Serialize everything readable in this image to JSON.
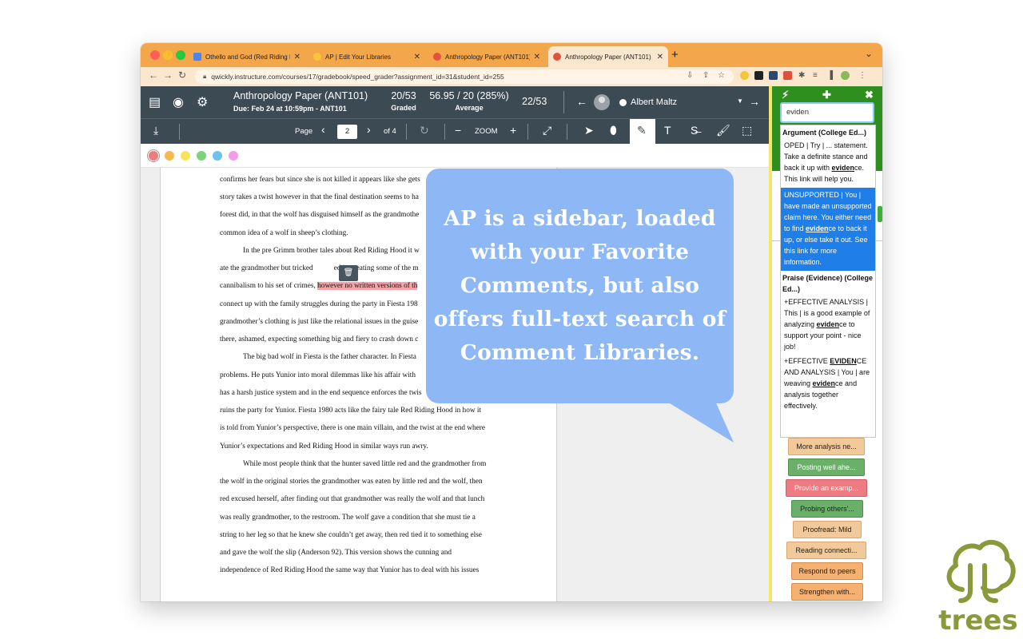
{
  "browser": {
    "tabs": [
      {
        "label": "Othello and God (Red Riding H",
        "color": "#4a86e8"
      },
      {
        "label": "AP | Edit Your Libraries",
        "color": "#f3c63b"
      },
      {
        "label": "Anthropology Paper (ANT101)",
        "color": "#e2533c"
      },
      {
        "label": "Anthropology Paper (ANT101)",
        "color": "#e2533c"
      }
    ],
    "new_tab": "+",
    "url": "qwickly.instructure.com/courses/17/gradebook/speed_grader?assignment_id=31&student_id=255"
  },
  "speedgrader": {
    "title": "Anthropology Paper (ANT101)",
    "due": "Due: Feb 24 at 10:59pm - ANT101",
    "graded_value": "20/53",
    "graded_label": "Graded",
    "average_value": "56.95 / 20 (285%)",
    "average_label": "Average",
    "position": "22/53",
    "student": "Albert Maltz"
  },
  "toolbar": {
    "page_label": "Page",
    "page_value": "2",
    "of_label": "of 4",
    "zoom_label": "ZOOM",
    "icons": [
      "download-icon",
      "rotate-icon",
      "zoom-out-icon",
      "zoom-in-icon",
      "fullscreen-icon",
      "pointer-icon",
      "pin-icon",
      "highlight-icon",
      "text-icon",
      "strikeout-icon",
      "draw-icon",
      "area-icon"
    ]
  },
  "annotation_colors": [
    "#ee7b80",
    "#f6b94d",
    "#f7e45a",
    "#7bd37b",
    "#6cc1f2",
    "#f59be8"
  ],
  "document": {
    "lines": [
      {
        "text": "confirms her fears but since she is not killed it appears like she gets",
        "indent": false
      },
      {
        "text": "story takes a twist however in that the final destination seems to ha",
        "indent": false
      },
      {
        "text": "forest did, in that the wolf has disguised himself as the grandmothe",
        "indent": false
      },
      {
        "text": "common idea of a wolf in sheep’s clothing.",
        "indent": false
      },
      {
        "text": "In the pre Grimm brother tales about Red Riding Hood it w",
        "indent": true
      },
      {
        "text": "ate the grandmother but tricked",
        "tail": "ed into eating some of the m",
        "indent": false
      },
      {
        "text": "cannibalism to his set of crimes, ",
        "highlight": "however no written versions of th",
        "indent": false
      },
      {
        "text": "connect up with the family struggles during the party in Fiesta 198",
        "indent": false
      },
      {
        "text": "grandmother’s clothing is just like the relational issues in the guise",
        "indent": false
      },
      {
        "text": "there, ashamed, expecting something big and fiery to crash down c",
        "indent": false
      },
      {
        "text": "The big bad wolf in Fiesta is the father character. In Fiesta",
        "indent": true
      },
      {
        "text": "problems. He puts Yunior into moral dilemmas like his affair with",
        "indent": false
      },
      {
        "text": "has a harsh justice system and in the end sequence enforces the twis",
        "indent": false
      },
      {
        "text": "ruins the party for Yunior. Fiesta 1980 acts like the fairy tale Red Riding Hood in how it",
        "indent": false
      },
      {
        "text": "is told from Yunior’s perspective, there is one main villain, and the twist at the end where",
        "indent": false
      },
      {
        "text": "Yunior’s expectations and Red Riding Hood in similar ways run awry.",
        "indent": false
      },
      {
        "text": "While most people think that the hunter saved little red and the grandmother from",
        "indent": true
      },
      {
        "text": "the wolf in the original stories the grandmother was eaten by little red and the wolf, then",
        "indent": false
      },
      {
        "text": "red excused herself, after finding out that grandmother was really the wolf and that lunch",
        "indent": false
      },
      {
        "text": "was really grandmother, to the restroom. The wolf gave a condition that she must tie a",
        "indent": false
      },
      {
        "text": "string to her leg so that he knew she couldn’t get away, then red tied it to something else",
        "indent": false
      },
      {
        "text": "and gave the wolf the slip (Anderson 92). This version shows the cunning and",
        "indent": false
      },
      {
        "text": "independence of Red Riding Hood the same way that Yunior has to deal with his issues",
        "indent": false
      }
    ]
  },
  "sidebar": {
    "search_value": "eviden",
    "results": [
      {
        "type": "group",
        "text": "Argument (College Ed...)"
      },
      {
        "type": "item",
        "selected": false,
        "parts": [
          "OPED | Try | ... statement. Take a definite stance and back it up with ",
          "eviden",
          "ce. This link will help you."
        ]
      },
      {
        "type": "item",
        "selected": true,
        "parts": [
          "UNSUPPORTED | You | have made an unsupported claim here. You either need to find ",
          "eviden",
          "ce to back it up, or else take it out. See this link for more information."
        ]
      },
      {
        "type": "group",
        "text": "Praise (Evidence) (College Ed...)"
      },
      {
        "type": "item",
        "selected": false,
        "parts": [
          "+EFFECTIVE ANALYSIS | This | is a good example of analyzing ",
          "eviden",
          "ce to support your point - nice job!"
        ]
      },
      {
        "type": "item",
        "selected": false,
        "parts": [
          "+EFFECTIVE ",
          "EVIDEN",
          "CE AND ANALYSIS | You | are weaving ",
          "eviden",
          "ce and analysis together effectively."
        ]
      }
    ],
    "chips": [
      {
        "label": "More analysis ne...",
        "bg": "#f2c99a",
        "fg": "#222"
      },
      {
        "label": "Posting well ahe...",
        "bg": "#6bb069",
        "fg": "#fff"
      },
      {
        "label": "Provide an examp...",
        "bg": "#ef7b82",
        "fg": "#fff"
      },
      {
        "label": "Probing others'...",
        "bg": "#6bb069",
        "fg": "#222"
      },
      {
        "label": "Proofread: Mild",
        "bg": "#f2c99a",
        "fg": "#222"
      },
      {
        "label": "Reading connecti...",
        "bg": "#f2c99a",
        "fg": "#222"
      },
      {
        "label": "Respond to peers",
        "bg": "#f4b172",
        "fg": "#222"
      },
      {
        "label": "Strengthen with...",
        "bg": "#f4b172",
        "fg": "#222"
      }
    ]
  },
  "callout": {
    "lines": [
      "AP is a sidebar, loaded",
      "with your Favorite",
      "Comments, but also",
      "offers full-text search of",
      "Comment Libraries."
    ],
    "color": "#8eb7f6"
  },
  "brand": {
    "name": "trees",
    "color": "#8a9a3b"
  }
}
